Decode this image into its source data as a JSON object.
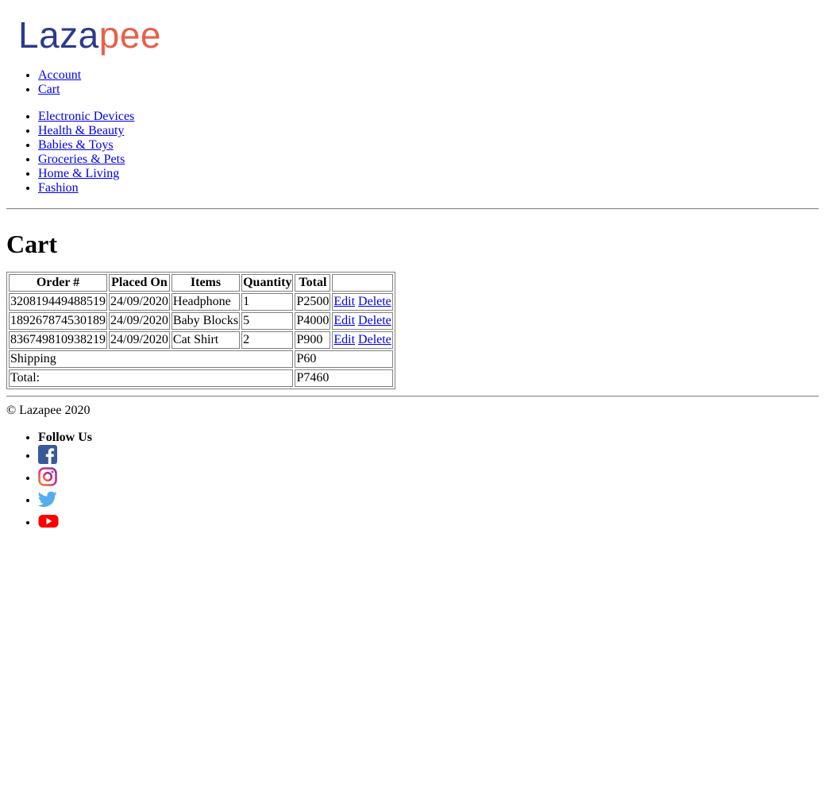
{
  "brand": {
    "part1": "Laza",
    "part2": "pee"
  },
  "nav": [
    "Account",
    "Cart"
  ],
  "categories": [
    "Electronic Devices",
    "Health & Beauty",
    "Babies & Toys",
    "Groceries & Pets",
    "Home & Living",
    "Fashion"
  ],
  "page_title": "Cart",
  "table": {
    "headers": [
      "Order #",
      "Placed On",
      "Items",
      "Quantity",
      "Total",
      ""
    ],
    "rows": [
      {
        "order": "320819449488519",
        "placed": "24/09/2020",
        "item": "Headphone",
        "qty": "1",
        "total": "P2500"
      },
      {
        "order": "189267874530189",
        "placed": "24/09/2020",
        "item": "Baby Blocks",
        "qty": "5",
        "total": "P4000"
      },
      {
        "order": "836749810938219",
        "placed": "24/09/2020",
        "item": "Cat Shirt",
        "qty": "2",
        "total": "P900"
      }
    ],
    "edit_label": "Edit",
    "delete_label": "Delete",
    "shipping_label": "Shipping",
    "shipping_value": "P60",
    "total_label": "Total:",
    "total_value": "P7460"
  },
  "footer": {
    "copyright": "© Lazapee 2020",
    "follow_label": "Follow Us",
    "social": [
      {
        "icon": "facebook-icon",
        "color": "#3b5998"
      },
      {
        "icon": "instagram-icon",
        "color": "#c13584"
      },
      {
        "icon": "twitter-icon",
        "color": "#55acee"
      },
      {
        "icon": "youtube-icon",
        "color": "#ff0000"
      }
    ]
  }
}
